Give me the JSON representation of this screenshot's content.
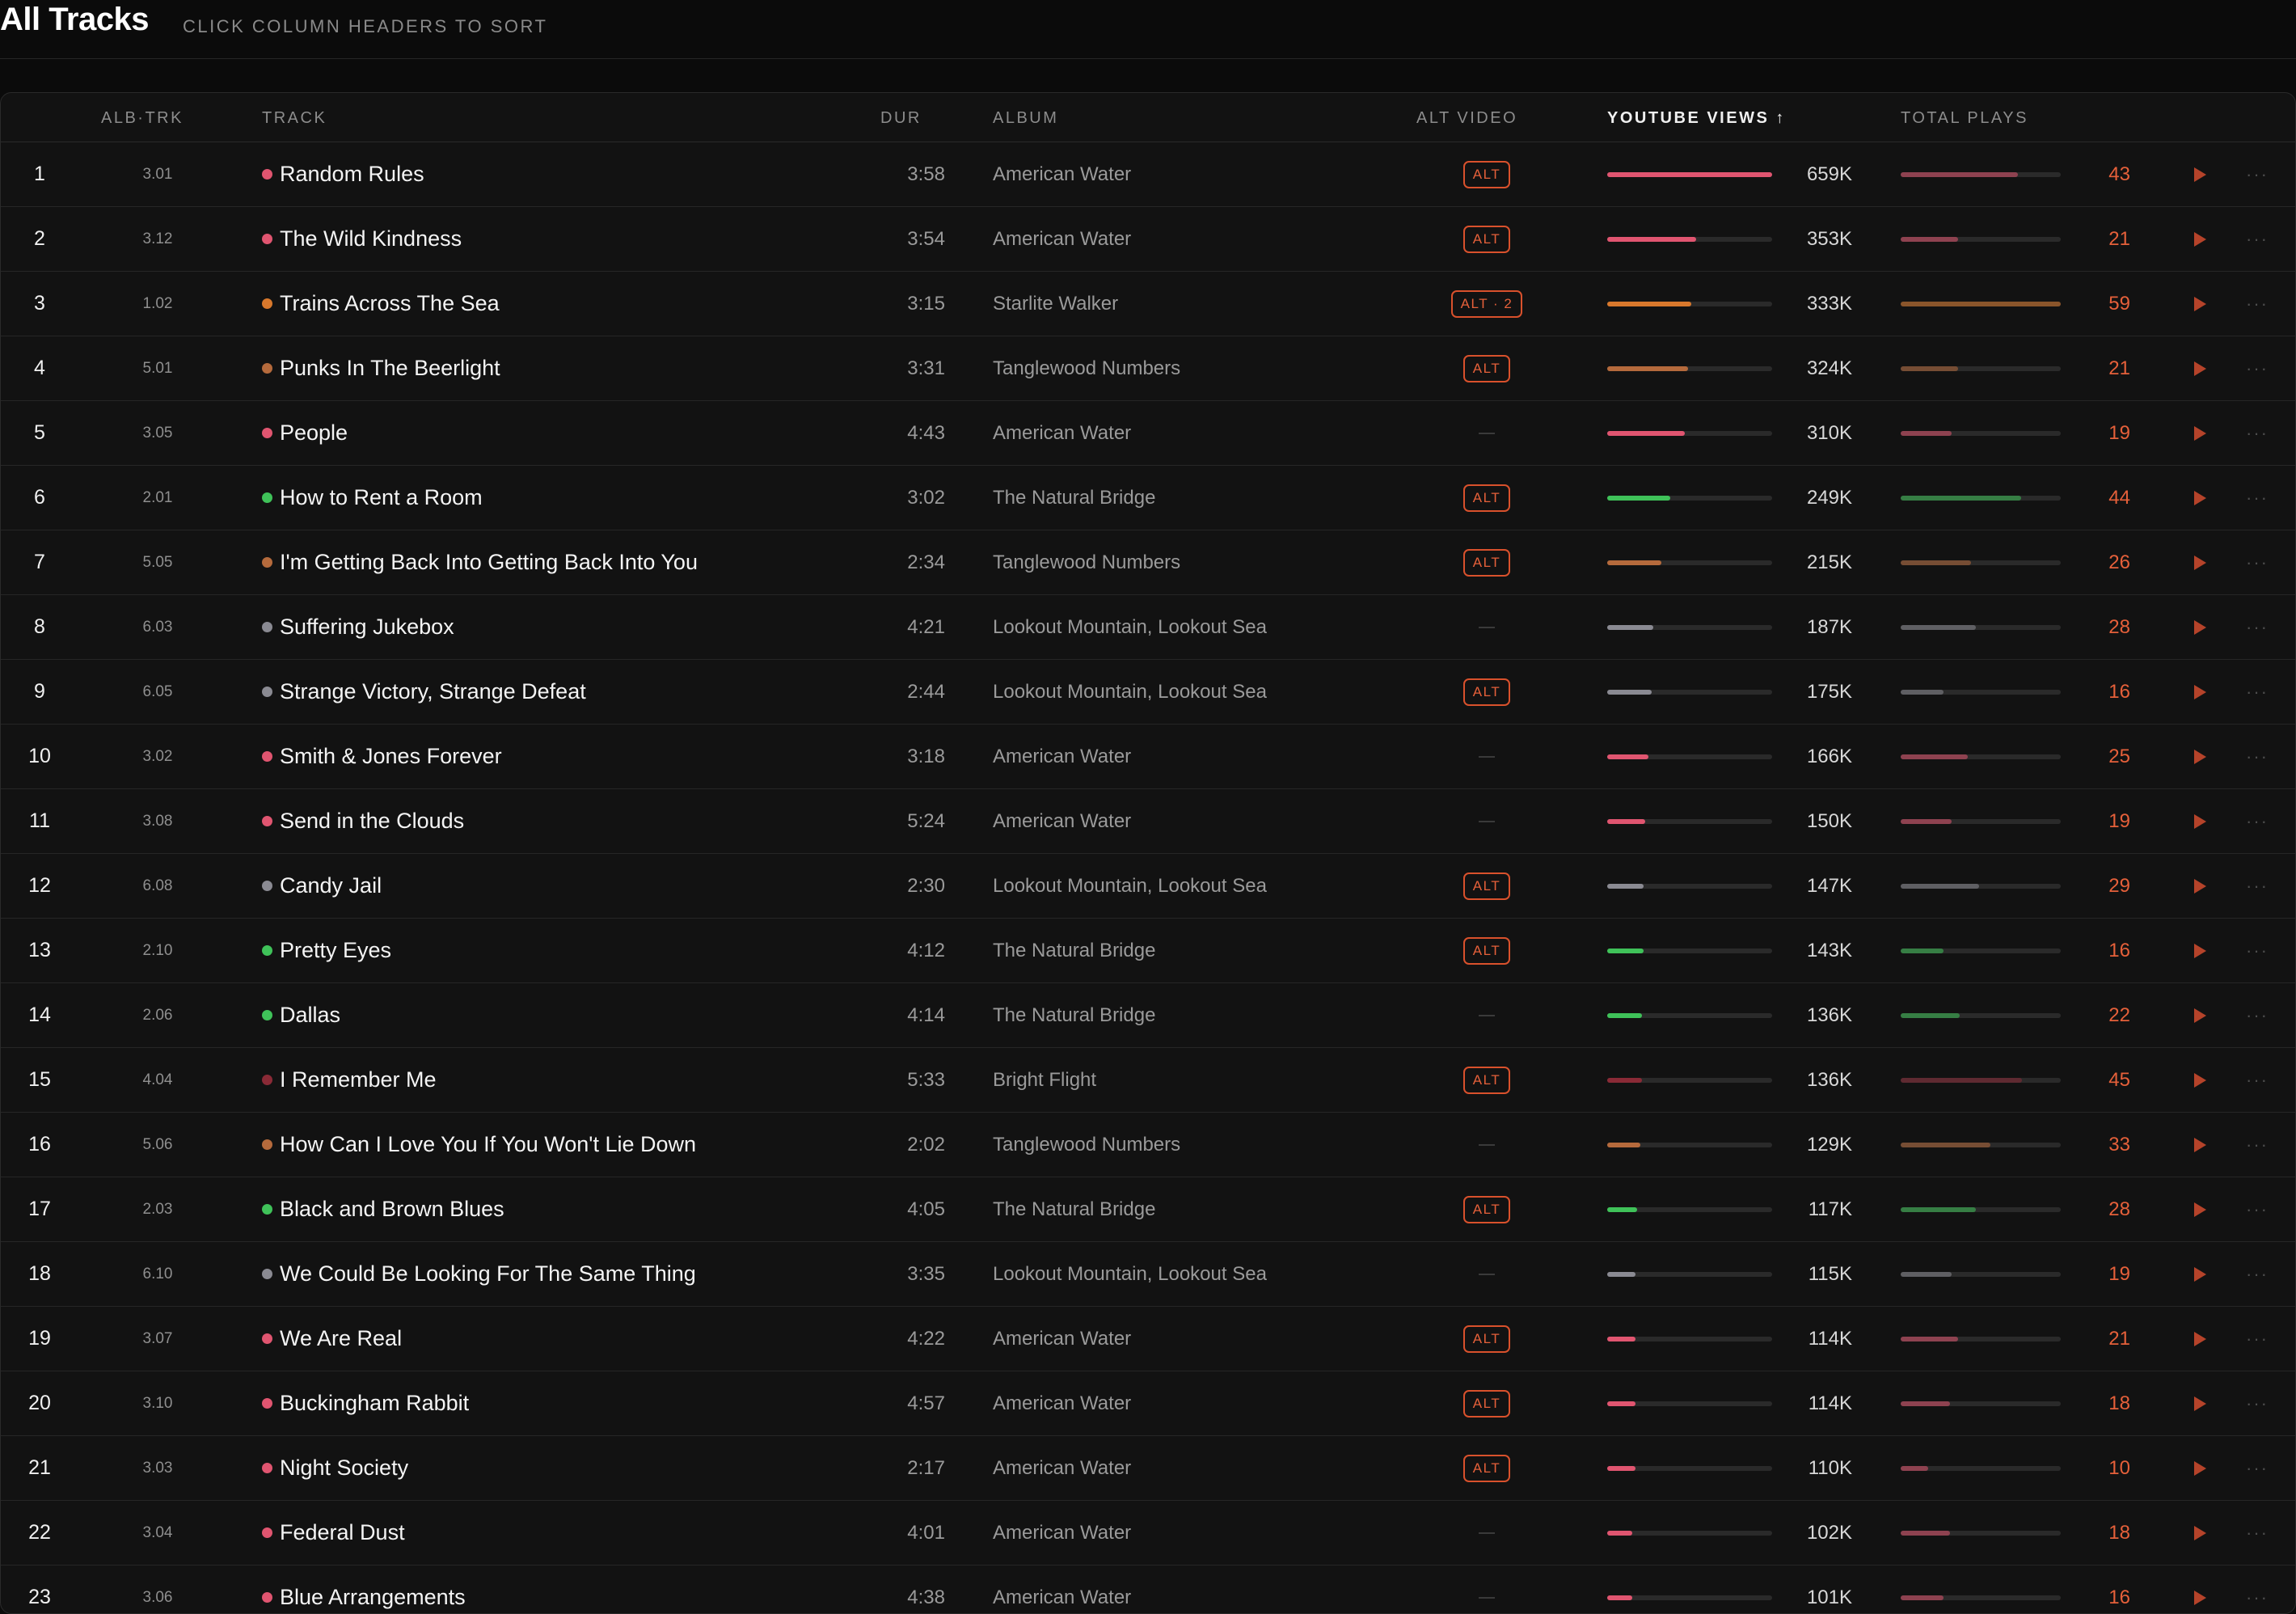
{
  "header": {
    "title": "All Tracks",
    "subtitle": "CLICK COLUMN HEADERS TO SORT"
  },
  "columns": {
    "alb_trk": "ALB·TRK",
    "track": "TRACK",
    "dur": "DUR",
    "album": "ALBUM",
    "alt_video": "ALT VIDEO",
    "youtube_views": "YOUTUBE VIEWS ↑",
    "total_plays": "TOTAL PLAYS"
  },
  "colors": {
    "american_water": "#e05570",
    "starlite_walker": "#d8782c",
    "tanglewood": "#b56a3c",
    "natural_bridge": "#3fc259",
    "lookout": "#8a8a92",
    "bright_flight": "#8a2a36",
    "accent": "#e5603a"
  },
  "icons": {
    "play": "play-icon",
    "more": "more-horizontal-icon"
  },
  "tracks": [
    {
      "rank": "1",
      "alb": "3.01",
      "title": "Random Rules",
      "dur": "3:58",
      "album": "American Water",
      "color": "#e05570",
      "alt": "ALT",
      "views": "659K",
      "views_pct": 100,
      "plays": "43",
      "plays_pct": 73
    },
    {
      "rank": "2",
      "alb": "3.12",
      "title": "The Wild Kindness",
      "dur": "3:54",
      "album": "American Water",
      "color": "#e05570",
      "alt": "ALT",
      "views": "353K",
      "views_pct": 54,
      "plays": "21",
      "plays_pct": 36
    },
    {
      "rank": "3",
      "alb": "1.02",
      "title": "Trains Across The Sea",
      "dur": "3:15",
      "album": "Starlite Walker",
      "color": "#d8782c",
      "alt": "ALT · 2",
      "views": "333K",
      "views_pct": 51,
      "plays": "59",
      "plays_pct": 100
    },
    {
      "rank": "4",
      "alb": "5.01",
      "title": "Punks In The Beerlight",
      "dur": "3:31",
      "album": "Tanglewood Numbers",
      "color": "#b56a3c",
      "alt": "ALT",
      "views": "324K",
      "views_pct": 49,
      "plays": "21",
      "plays_pct": 36
    },
    {
      "rank": "5",
      "alb": "3.05",
      "title": "People",
      "dur": "4:43",
      "album": "American Water",
      "color": "#e05570",
      "alt": "",
      "views": "310K",
      "views_pct": 47,
      "plays": "19",
      "plays_pct": 32
    },
    {
      "rank": "6",
      "alb": "2.01",
      "title": "How to Rent a Room",
      "dur": "3:02",
      "album": "The Natural Bridge",
      "color": "#3fc259",
      "alt": "ALT",
      "views": "249K",
      "views_pct": 38,
      "plays": "44",
      "plays_pct": 75
    },
    {
      "rank": "7",
      "alb": "5.05",
      "title": "I'm Getting Back Into Getting Back Into You",
      "dur": "2:34",
      "album": "Tanglewood Numbers",
      "color": "#b56a3c",
      "alt": "ALT",
      "views": "215K",
      "views_pct": 33,
      "plays": "26",
      "plays_pct": 44
    },
    {
      "rank": "8",
      "alb": "6.03",
      "title": "Suffering Jukebox",
      "dur": "4:21",
      "album": "Lookout Mountain, Lookout Sea",
      "color": "#8a8a92",
      "alt": "",
      "views": "187K",
      "views_pct": 28,
      "plays": "28",
      "plays_pct": 47
    },
    {
      "rank": "9",
      "alb": "6.05",
      "title": "Strange Victory, Strange Defeat",
      "dur": "2:44",
      "album": "Lookout Mountain, Lookout Sea",
      "color": "#8a8a92",
      "alt": "ALT",
      "views": "175K",
      "views_pct": 27,
      "plays": "16",
      "plays_pct": 27
    },
    {
      "rank": "10",
      "alb": "3.02",
      "title": "Smith & Jones Forever",
      "dur": "3:18",
      "album": "American Water",
      "color": "#e05570",
      "alt": "",
      "views": "166K",
      "views_pct": 25,
      "plays": "25",
      "plays_pct": 42
    },
    {
      "rank": "11",
      "alb": "3.08",
      "title": "Send in the Clouds",
      "dur": "5:24",
      "album": "American Water",
      "color": "#e05570",
      "alt": "",
      "views": "150K",
      "views_pct": 23,
      "plays": "19",
      "plays_pct": 32
    },
    {
      "rank": "12",
      "alb": "6.08",
      "title": "Candy Jail",
      "dur": "2:30",
      "album": "Lookout Mountain, Lookout Sea",
      "color": "#8a8a92",
      "alt": "ALT",
      "views": "147K",
      "views_pct": 22,
      "plays": "29",
      "plays_pct": 49
    },
    {
      "rank": "13",
      "alb": "2.10",
      "title": "Pretty Eyes",
      "dur": "4:12",
      "album": "The Natural Bridge",
      "color": "#3fc259",
      "alt": "ALT",
      "views": "143K",
      "views_pct": 22,
      "plays": "16",
      "plays_pct": 27
    },
    {
      "rank": "14",
      "alb": "2.06",
      "title": "Dallas",
      "dur": "4:14",
      "album": "The Natural Bridge",
      "color": "#3fc259",
      "alt": "",
      "views": "136K",
      "views_pct": 21,
      "plays": "22",
      "plays_pct": 37
    },
    {
      "rank": "15",
      "alb": "4.04",
      "title": "I Remember Me",
      "dur": "5:33",
      "album": "Bright Flight",
      "color": "#8a2a36",
      "alt": "ALT",
      "views": "136K",
      "views_pct": 21,
      "plays": "45",
      "plays_pct": 76
    },
    {
      "rank": "16",
      "alb": "5.06",
      "title": "How Can I Love You If You Won't Lie Down",
      "dur": "2:02",
      "album": "Tanglewood Numbers",
      "color": "#b56a3c",
      "alt": "",
      "views": "129K",
      "views_pct": 20,
      "plays": "33",
      "plays_pct": 56
    },
    {
      "rank": "17",
      "alb": "2.03",
      "title": "Black and Brown Blues",
      "dur": "4:05",
      "album": "The Natural Bridge",
      "color": "#3fc259",
      "alt": "ALT",
      "views": "117K",
      "views_pct": 18,
      "plays": "28",
      "plays_pct": 47
    },
    {
      "rank": "18",
      "alb": "6.10",
      "title": "We Could Be Looking For The Same Thing",
      "dur": "3:35",
      "album": "Lookout Mountain, Lookout Sea",
      "color": "#8a8a92",
      "alt": "",
      "views": "115K",
      "views_pct": 17,
      "plays": "19",
      "plays_pct": 32
    },
    {
      "rank": "19",
      "alb": "3.07",
      "title": "We Are Real",
      "dur": "4:22",
      "album": "American Water",
      "color": "#e05570",
      "alt": "ALT",
      "views": "114K",
      "views_pct": 17,
      "plays": "21",
      "plays_pct": 36
    },
    {
      "rank": "20",
      "alb": "3.10",
      "title": "Buckingham Rabbit",
      "dur": "4:57",
      "album": "American Water",
      "color": "#e05570",
      "alt": "ALT",
      "views": "114K",
      "views_pct": 17,
      "plays": "18",
      "plays_pct": 31
    },
    {
      "rank": "21",
      "alb": "3.03",
      "title": "Night Society",
      "dur": "2:17",
      "album": "American Water",
      "color": "#e05570",
      "alt": "ALT",
      "views": "110K",
      "views_pct": 17,
      "plays": "10",
      "plays_pct": 17
    },
    {
      "rank": "22",
      "alb": "3.04",
      "title": "Federal Dust",
      "dur": "4:01",
      "album": "American Water",
      "color": "#e05570",
      "alt": "",
      "views": "102K",
      "views_pct": 15,
      "plays": "18",
      "plays_pct": 31
    },
    {
      "rank": "23",
      "alb": "3.06",
      "title": "Blue Arrangements",
      "dur": "4:38",
      "album": "American Water",
      "color": "#e05570",
      "alt": "",
      "views": "101K",
      "views_pct": 15,
      "plays": "16",
      "plays_pct": 27
    }
  ]
}
